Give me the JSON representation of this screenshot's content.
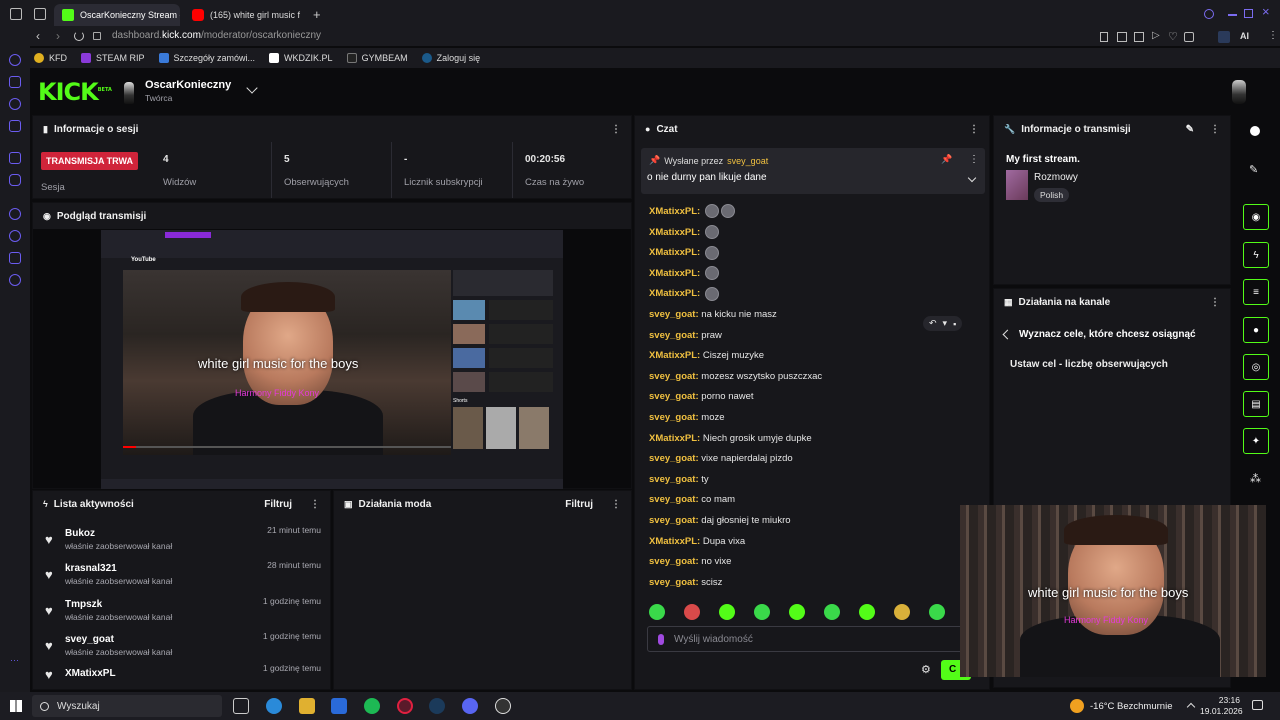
{
  "browser": {
    "tabs": [
      {
        "title": "OscarKonieczny Stream -",
        "active": true
      },
      {
        "title": "(165) white girl music f",
        "active": false
      }
    ],
    "url_prefix": "dashboard.",
    "url_domain": "kick.com",
    "url_path": "/moderator/oscarkonieczny",
    "bookmarks": [
      "KFD",
      "STEAM RIP",
      "Szczegóły zamówi...",
      "WKDZIK.PL",
      "GYMBEAM",
      "Zaloguj się"
    ],
    "ai_label": "AI"
  },
  "header": {
    "logo": "KICK",
    "logo_badge": "BETA",
    "channel_name": "OscarKonieczny",
    "channel_role": "Twórca"
  },
  "session": {
    "title": "Informacje o sesji",
    "live_badge": "TRANSMISJA TRWA",
    "session_label": "Sesja",
    "stats": [
      {
        "value": "4",
        "label": "Widzów"
      },
      {
        "value": "5",
        "label": "Obserwujących"
      },
      {
        "value": "-",
        "label": "Licznik subskrypcji"
      },
      {
        "value": "00:20:56",
        "label": "Czas na żywo"
      }
    ]
  },
  "preview": {
    "title": "Podgląd transmisji",
    "caption": "white girl music for the boys",
    "caption_pink": "Harmony Fiddy Kony",
    "yt_logo": "YouTube",
    "yt_side_header": "Shorts"
  },
  "activity": {
    "title": "Lista aktywności",
    "filter_label": "Filtruj",
    "items": [
      {
        "name": "Bukoz",
        "desc": "właśnie zaobserwował kanał",
        "time": "21 minut temu"
      },
      {
        "name": "krasnal321",
        "desc": "właśnie zaobserwował kanał",
        "time": "28 minut temu"
      },
      {
        "name": "Tmpszk",
        "desc": "właśnie zaobserwował kanał",
        "time": "1 godzinę temu"
      },
      {
        "name": "svey_goat",
        "desc": "właśnie zaobserwował kanał",
        "time": "1 godzinę temu"
      },
      {
        "name": "XMatixxPL",
        "desc": "",
        "time": "1 godzinę temu"
      }
    ]
  },
  "mod": {
    "title": "Działania moda",
    "filter_label": "Filtruj"
  },
  "chat": {
    "title": "Czat",
    "pinned_label": "Wysłane przez",
    "pinned_user": "svey_goat",
    "pinned_message": "o nie durny pan likuje dane",
    "messages": [
      {
        "user": "XMatixxPL:",
        "text": "",
        "emotes": 2
      },
      {
        "user": "XMatixxPL:",
        "text": "",
        "emotes": 1
      },
      {
        "user": "XMatixxPL:",
        "text": "",
        "emotes": 1
      },
      {
        "user": "XMatixxPL:",
        "text": "",
        "emotes": 1
      },
      {
        "user": "XMatixxPL:",
        "text": "",
        "emotes": 1
      },
      {
        "user": "svey_goat:",
        "text": "na kicku nie masz",
        "emotes": 0
      },
      {
        "user": "svey_goat:",
        "text": "praw",
        "emotes": 0
      },
      {
        "user": "XMatixxPL:",
        "text": "Ciszej muzyke",
        "emotes": 0
      },
      {
        "user": "svey_goat:",
        "text": "mozesz wszytsko puszczxac",
        "emotes": 0
      },
      {
        "user": "svey_goat:",
        "text": "porno nawet",
        "emotes": 0
      },
      {
        "user": "svey_goat:",
        "text": "moze",
        "emotes": 0
      },
      {
        "user": "XMatixxPL:",
        "text": "Niech grosik umyje dupke",
        "emotes": 0
      },
      {
        "user": "svey_goat:",
        "text": "vixe napierdalaj pizdo",
        "emotes": 0
      },
      {
        "user": "svey_goat:",
        "text": "ty",
        "emotes": 0
      },
      {
        "user": "svey_goat:",
        "text": "co mam",
        "emotes": 0
      },
      {
        "user": "svey_goat:",
        "text": "daj głosniej te miukro",
        "emotes": 0
      },
      {
        "user": "XMatixxPL:",
        "text": "Dupa vixa",
        "emotes": 0
      },
      {
        "user": "svey_goat:",
        "text": "no vixe",
        "emotes": 0
      },
      {
        "user": "svey_goat:",
        "text": "scisz",
        "emotes": 0
      }
    ],
    "input_placeholder": "Wyślij wiadomość",
    "send_label": "C"
  },
  "stream_info": {
    "title": "Informacje o transmisji",
    "stream_title": "My first stream.",
    "category": "Rozmowy",
    "language_tag": "Polish"
  },
  "channel_actions": {
    "title": "Działania na kanale",
    "goal_header": "Wyznacz cele, które chcesz osiągnąć",
    "goal_item": "Ustaw cel - liczbę obserwujących"
  },
  "webcam": {
    "caption": "white girl music for the boys",
    "caption_pink": "Harmony Fiddy Kony"
  },
  "taskbar": {
    "search_label": "Wyszukaj",
    "weather": "-16°C Bezchmurnie",
    "time": "23:16",
    "date": "19.01.2026"
  },
  "colors": {
    "kick_green": "#53fc18",
    "live_red": "#d0243a",
    "username_gold": "#f0c040"
  }
}
